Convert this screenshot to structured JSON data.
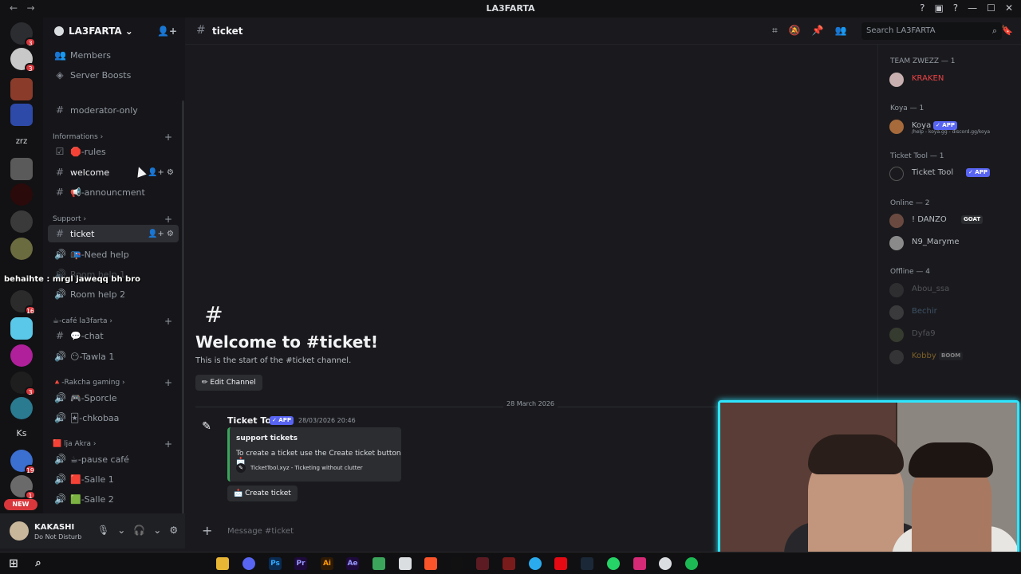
{
  "window": {
    "title": "LA3FARTA",
    "nav_back": "←",
    "nav_fwd": "→",
    "help": "?",
    "inbox": "▣",
    "min": "—",
    "max": "☐",
    "close": "✕"
  },
  "rail": {
    "new_badge": "NEW",
    "label_zrz": "zrz",
    "label_ks": "Ks",
    "badges": [
      "3",
      "3",
      "16",
      "3",
      "19",
      "1"
    ]
  },
  "server": {
    "name": "LA3FARTA ⌄"
  },
  "sidebar": {
    "members": "Members",
    "boosts": "Server Boosts",
    "moderator": "moderator-only",
    "cat_info": "Informations ›",
    "rules": "🛑-rules",
    "welcome": "welcome",
    "announce": "📢-announcment",
    "cat_support": "Support ›",
    "ticket": "ticket",
    "needhelp": "📭-Need help",
    "roomhelp1": "Room help 1",
    "roomhelp2": "Room help 2",
    "cat_cafe": "☕-café la3farta ›",
    "chat": "💬-chat",
    "tawla": "😶-Tawla 1",
    "cat_rakcha": "🔺-Rakcha gaming ›",
    "sporcle": "🎮-Sporcle",
    "chkobaa": "🃏-chkobaa",
    "cat_akra": "🟥 lja Akra ›",
    "pause": "☕-pause café",
    "salle1": "🟥-Salle 1",
    "salle2": "🟩-Salle 2"
  },
  "user": {
    "name": "KAKASHI",
    "status": "Do Not Disturb"
  },
  "topbar": {
    "channel": "ticket",
    "search_placeholder": "Search LA3FARTA"
  },
  "welcome": {
    "hash": "#",
    "title": "Welcome to #ticket!",
    "sub": "This is the start of the #ticket channel.",
    "edit": "✏ Edit Channel"
  },
  "divider_date": "28 March 2026",
  "message": {
    "author": "Ticket Tool",
    "tag": "✓ APP",
    "time": "28/03/2026 20:46",
    "embed_title": "support tickets",
    "embed_desc": "To create a ticket use the Create ticket button 📩",
    "embed_footer": "TicketTool.xyz - Ticketing without clutter",
    "button": "📩 Create ticket"
  },
  "composer": {
    "placeholder": "Message #ticket"
  },
  "members": {
    "g1": "TEAM ZWEZZ — 1",
    "kraken": "KRAKEN",
    "g2": "Koya — 1",
    "koya": "Koya",
    "koya_tag": "✓ APP",
    "koya_sub": "/help - koya.gg - discord.gg/koya",
    "g3": "Ticket Tool — 1",
    "tickettool": "Ticket Tool",
    "tt_tag": "✓ APP",
    "g4": "Online — 2",
    "danzo": "! DANZO",
    "danzo_tag": "GOAT",
    "maryme": "N9_Maryme",
    "g5": "Offline — 4",
    "abou": "Abou_ssa",
    "bechir": "Bechir",
    "dylan": "Dyfa9",
    "kobby": "Kobby",
    "kobby_tag": "BOOM"
  },
  "overlay_text": "behaihte : mrgl jaweqq bh bro",
  "colors": {
    "accent": "#5865f2",
    "dnd": "#da373c",
    "online": "#23a55a",
    "cam_border": "#2ee6ff"
  }
}
